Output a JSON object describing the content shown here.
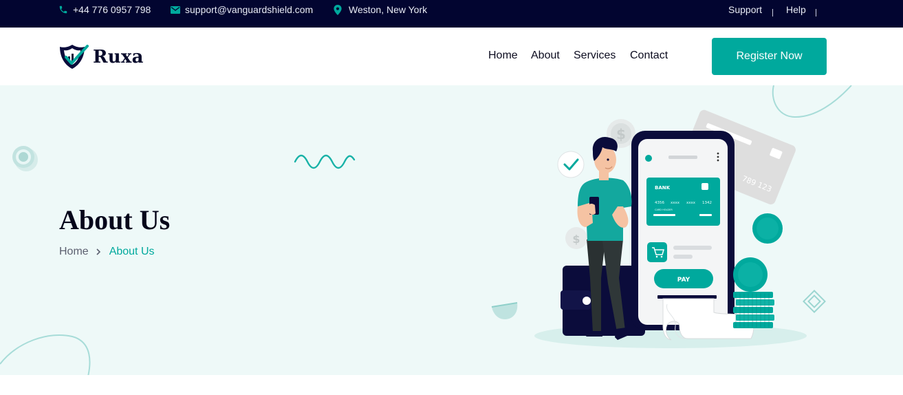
{
  "topbar": {
    "phone": "+44 776 0957 798",
    "email": "support@vanguardshield.com",
    "location": "Weston, New York",
    "links": [
      "Support",
      "Help"
    ],
    "icons": [
      "phone-icon",
      "mail-icon",
      "location-pin-icon"
    ]
  },
  "header": {
    "logo_text": "Ruxa",
    "nav": [
      "Home",
      "About",
      "Services",
      "Contact"
    ],
    "cta": "Register Now"
  },
  "hero": {
    "title": "About Us",
    "breadcrumb": {
      "home": "Home",
      "current": "About Us"
    }
  },
  "illustration": {
    "card_label": "BANK",
    "card_number": [
      "4356",
      "xxxx",
      "xxxx",
      "1342"
    ],
    "card_holder": "CARD HOLDER",
    "pay_label": "PAY",
    "back_card_number": "789 123",
    "currency_symbol": "$"
  },
  "colors": {
    "accent": "#00a99d",
    "topbar_bg": "#020530",
    "hero_bg": "#eef9f8",
    "navy": "#0b0c3b"
  }
}
